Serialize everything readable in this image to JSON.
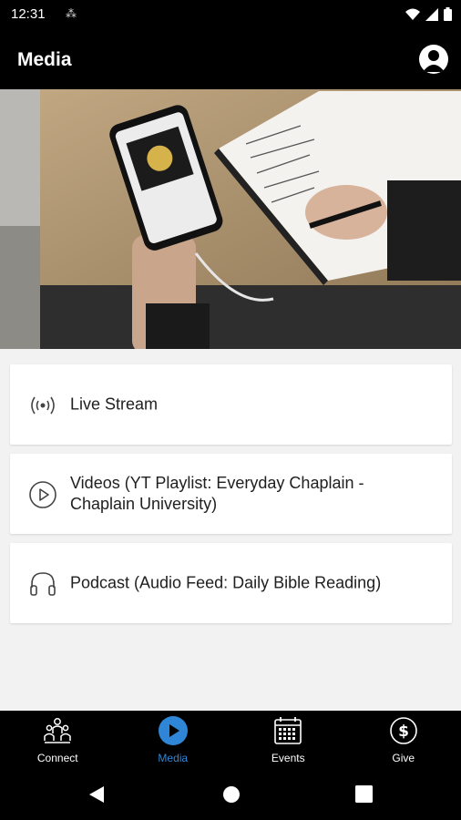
{
  "status_bar": {
    "time": "12:31"
  },
  "app_bar": {
    "title": "Media"
  },
  "hero": {
    "alt": "Person writing in a notebook while holding a phone"
  },
  "media_items": [
    {
      "label": "Live Stream",
      "icon": "broadcast-icon"
    },
    {
      "label": "Videos (YT Playlist: Everyday Chaplain - Chaplain University)",
      "icon": "play-circle-icon"
    },
    {
      "label": "Podcast (Audio Feed: Daily Bible Reading)",
      "icon": "headphones-icon"
    }
  ],
  "bottom_nav": {
    "items": [
      {
        "label": "Connect",
        "icon": "people-icon",
        "active": false
      },
      {
        "label": "Media",
        "icon": "play-icon",
        "active": true
      },
      {
        "label": "Events",
        "icon": "calendar-icon",
        "active": false
      },
      {
        "label": "Give",
        "icon": "dollar-icon",
        "active": false
      }
    ],
    "active_color": "#2f86d6"
  },
  "colors": {
    "bar_background": "#000000",
    "page_background": "#f2f2f2",
    "accent": "#2f86d6"
  }
}
